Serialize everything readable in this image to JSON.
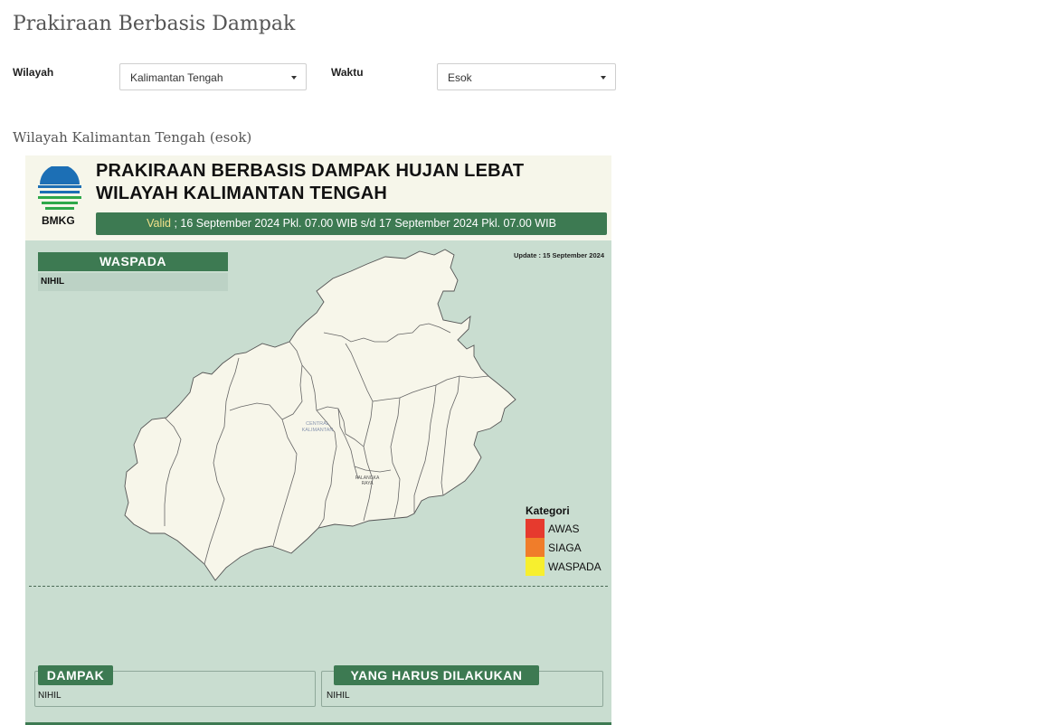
{
  "page": {
    "title": "Prakiraan Berbasis Dampak"
  },
  "filters": {
    "region_label": "Wilayah",
    "region_value": "Kalimantan Tengah",
    "time_label": "Waktu",
    "time_value": "Esok"
  },
  "section": {
    "title": "Wilayah Kalimantan Tengah (esok)"
  },
  "poster": {
    "logo_text": "BMKG",
    "title_line1": "PRAKIRAAN BERBASIS DAMPAK HUJAN LEBAT",
    "title_line2": "WILAYAH KALIMANTAN TENGAH",
    "valid_word": "Valid",
    "valid_rest": " ; 16 September 2024 Pkl. 07.00 WIB s/d 17 September 2024 Pkl. 07.00 WIB",
    "update_note": "Update : 15 September 2024",
    "waspada_title": "WASPADA",
    "waspada_value": "NIHIL",
    "map_label_province_1": "CENTRAL",
    "map_label_province_2": "KALIMANTAN",
    "map_label_city_1": "PALANGKA",
    "map_label_city_2": "RAYA",
    "legend_title": "Kategori",
    "legend": [
      {
        "label": "AWAS",
        "color": "#e63a2e"
      },
      {
        "label": "SIAGA",
        "color": "#f07d2a"
      },
      {
        "label": "WASPADA",
        "color": "#f7ef2e"
      }
    ],
    "dampak_title": "DAMPAK",
    "dampak_value": "NIHIL",
    "tindakan_title": "YANG HARUS DILAKUKAN",
    "tindakan_value": "NIHIL"
  },
  "colors": {
    "poster_green": "#3d7a52",
    "poster_bg": "#c9ddd0",
    "map_fill": "#f7f6ea"
  }
}
